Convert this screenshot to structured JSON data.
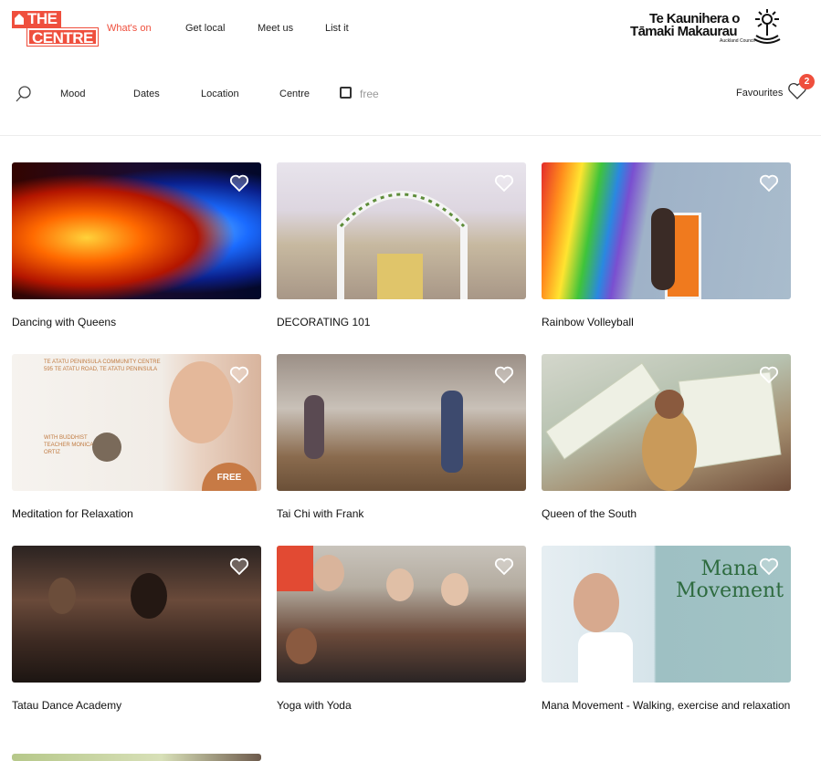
{
  "brand": {
    "logo_line1": "THE",
    "logo_line2": "CENTRE",
    "accent_color": "#ef4f3d"
  },
  "nav": {
    "items": [
      {
        "label": "What's on",
        "active": true
      },
      {
        "label": "Get local",
        "active": false
      },
      {
        "label": "Meet us",
        "active": false
      },
      {
        "label": "List it",
        "active": false
      }
    ]
  },
  "council": {
    "line1": "Te Kaunihera o",
    "line2": "Tāmaki Makaurau",
    "line3": "Auckland Council"
  },
  "filters": {
    "search_icon": "search-icon",
    "items": [
      "Mood",
      "Dates",
      "Location",
      "Centre"
    ],
    "free_label": "free",
    "free_checked": false
  },
  "favourites": {
    "label": "Favourites",
    "count": "2",
    "icon": "heart-icon"
  },
  "events": [
    {
      "title": "Dancing with Queens"
    },
    {
      "title": "DECORATING 101"
    },
    {
      "title": "Rainbow Volleyball"
    },
    {
      "title": "Meditation for Relaxation"
    },
    {
      "title": "Tai Chi with Frank"
    },
    {
      "title": "Queen of the South"
    },
    {
      "title": "Tatau Dance Academy"
    },
    {
      "title": "Yoga with Yoda"
    },
    {
      "title": "Mana Movement - Walking, exercise and relaxation"
    }
  ],
  "posters": {
    "mana_heading": "Mana Movement",
    "meditation_header": "TE ATATU PENINSULA COMMUNITY CENTRE\n595 TE ATATU ROAD, TE ATATU PENINSULA",
    "meditation_teacher": "WITH BUDDHIST TEACHER MONICA ORTIZ",
    "meditation_free": "FREE"
  }
}
